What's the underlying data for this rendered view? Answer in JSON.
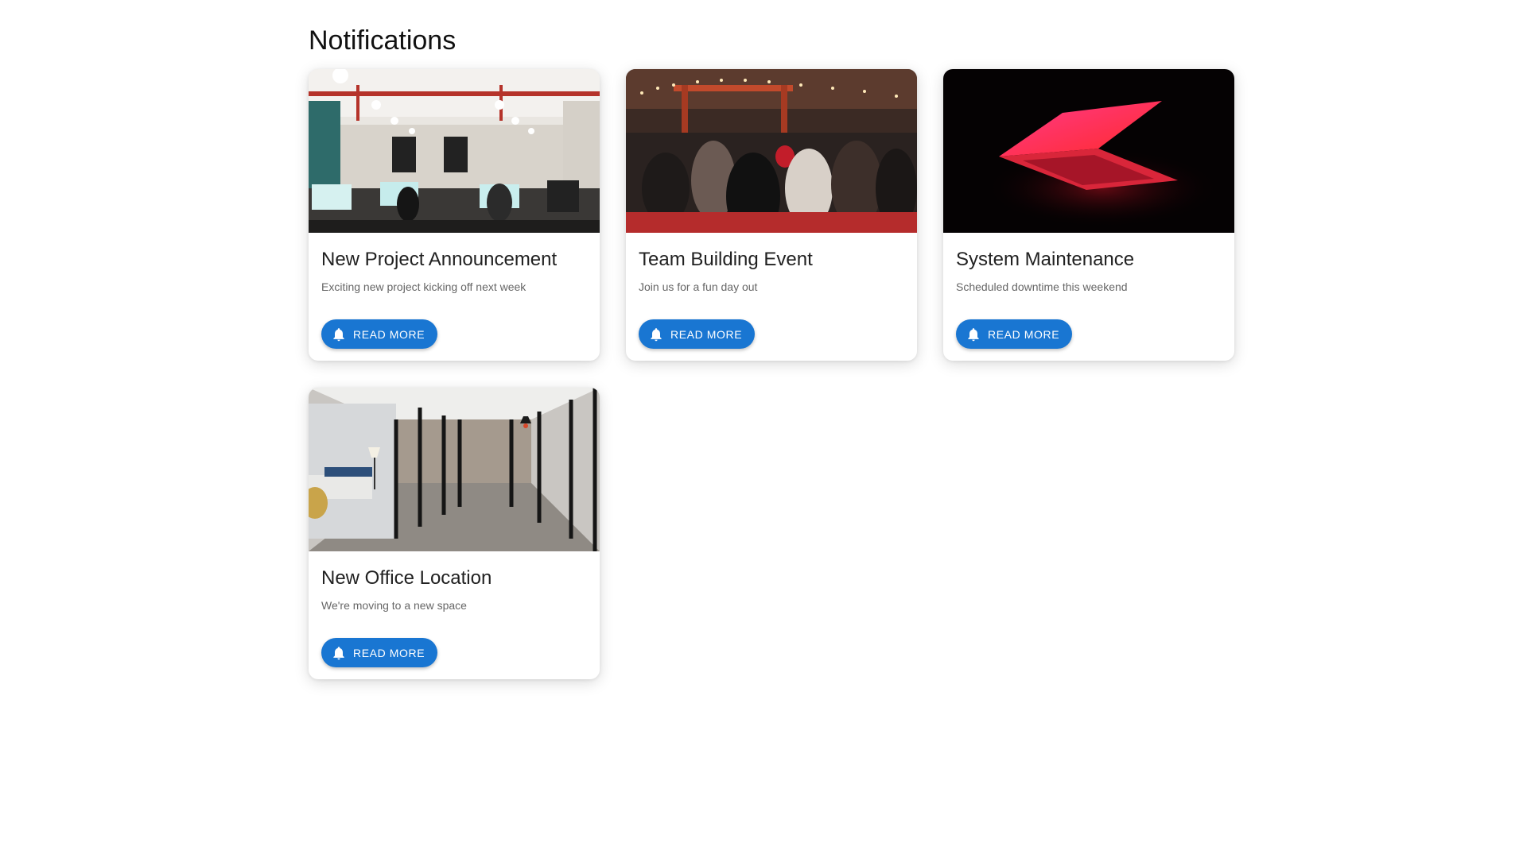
{
  "page": {
    "title": "Notifications"
  },
  "notifications": [
    {
      "title": "New Project Announcement",
      "description": "Exciting new project kicking off next week",
      "button_label": "READ MORE",
      "button_icon": "bell-icon",
      "image": "open-office-photo"
    },
    {
      "title": "Team Building Event",
      "description": "Join us for a fun day out",
      "button_label": "READ MORE",
      "button_icon": "bell-icon",
      "image": "crowd-party-photo"
    },
    {
      "title": "System Maintenance",
      "description": "Scheduled downtime this weekend",
      "button_label": "READ MORE",
      "button_icon": "bell-icon",
      "image": "red-laptop-photo"
    },
    {
      "title": "New Office Location",
      "description": "We're moving to a new space",
      "button_label": "READ MORE",
      "button_icon": "bell-icon",
      "image": "glass-hallway-photo"
    }
  ],
  "colors": {
    "accent": "#1976d2",
    "text": "#212121",
    "muted": "#666666"
  }
}
